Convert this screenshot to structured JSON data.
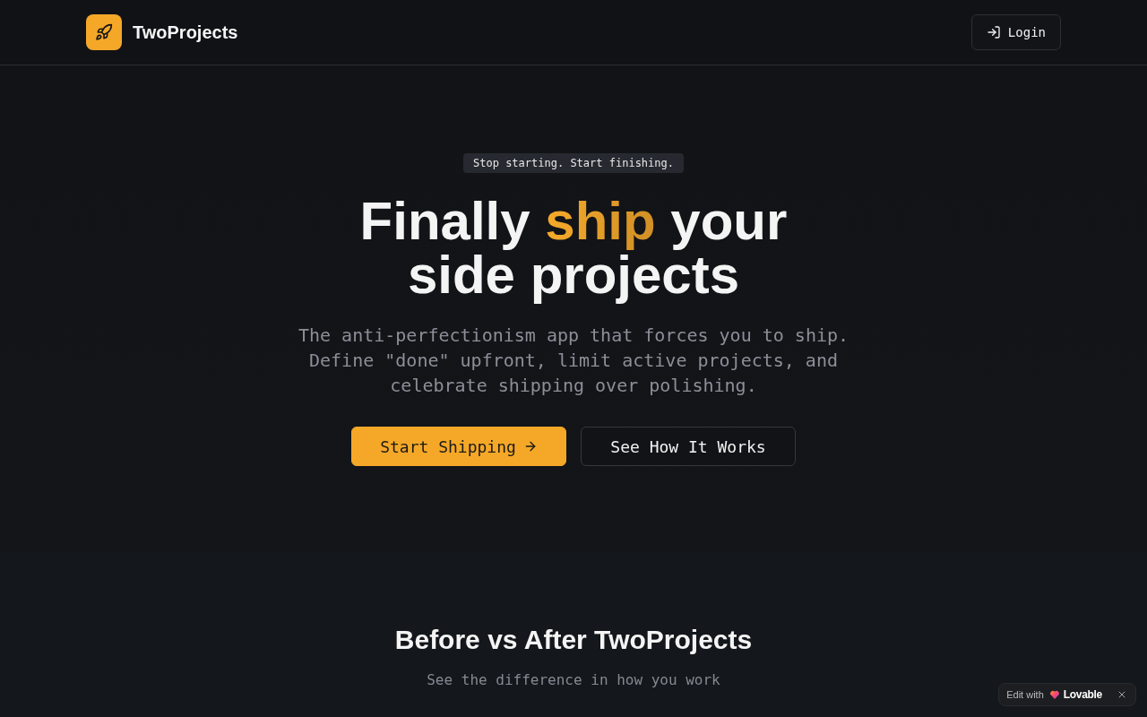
{
  "header": {
    "brand": "TwoProjects",
    "login_button": "Login"
  },
  "hero": {
    "badge": "Stop starting. Start finishing.",
    "heading": [
      {
        "text": "Finally ",
        "highlight": false
      },
      {
        "text": "ship",
        "highlight": true
      },
      {
        "text": " your side projects",
        "highlight": false
      }
    ],
    "subtitle": "The anti-perfectionism app that forces you to ship. Define \"done\" upfront, limit active projects, and celebrate shipping over polishing.",
    "buttons": [
      {
        "label": "Start Shipping",
        "kind": "primary"
      },
      {
        "label": "See How It Works",
        "kind": "outline"
      }
    ]
  },
  "comparison": {
    "title": "Before vs After TwoProjects",
    "subtitle": "See the difference in how you work"
  },
  "edit_badge": {
    "label": "Edit with",
    "brand": "Lovable"
  }
}
